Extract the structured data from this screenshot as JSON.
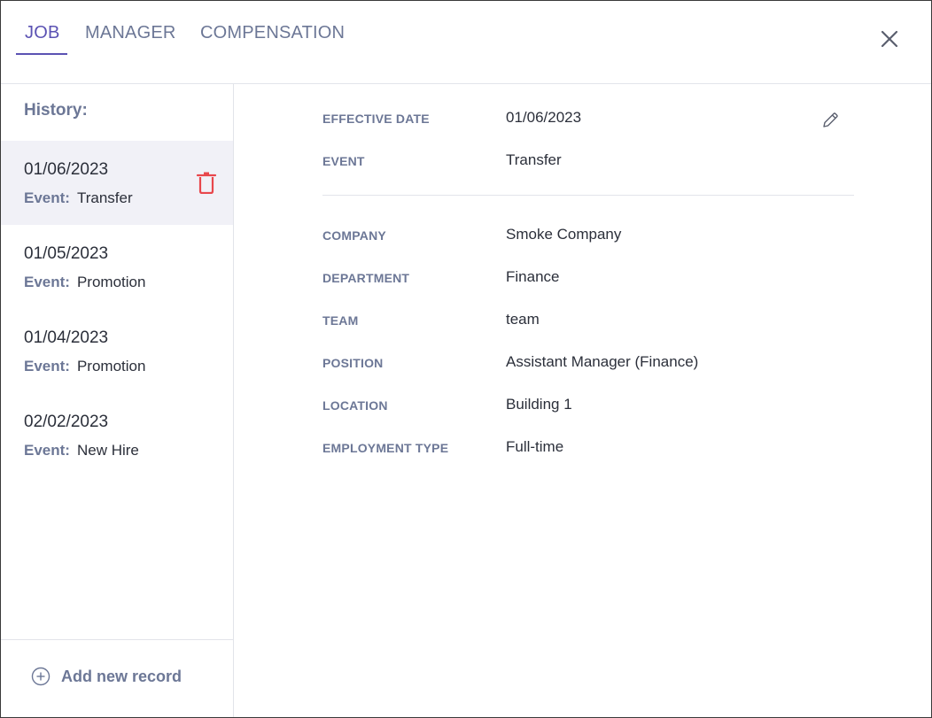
{
  "tabs": [
    {
      "label": "JOB",
      "active": true
    },
    {
      "label": "MANAGER",
      "active": false
    },
    {
      "label": "COMPENSATION",
      "active": false
    }
  ],
  "sidebar": {
    "title": "History:",
    "event_label": "Event:",
    "items": [
      {
        "date": "01/06/2023",
        "event": "Transfer",
        "selected": true
      },
      {
        "date": "01/05/2023",
        "event": "Promotion",
        "selected": false
      },
      {
        "date": "01/04/2023",
        "event": "Promotion",
        "selected": false
      },
      {
        "date": "02/02/2023",
        "event": "New Hire",
        "selected": false
      }
    ],
    "add_record_label": "Add new record"
  },
  "details": {
    "effective_date": {
      "label": "EFFECTIVE DATE",
      "value": "01/06/2023"
    },
    "event": {
      "label": "EVENT",
      "value": "Transfer"
    },
    "company": {
      "label": "COMPANY",
      "value": "Smoke Company"
    },
    "department": {
      "label": "DEPARTMENT",
      "value": "Finance"
    },
    "team": {
      "label": "TEAM",
      "value": "team"
    },
    "position": {
      "label": "POSITION",
      "value": "Assistant Manager (Finance)"
    },
    "location": {
      "label": "LOCATION",
      "value": "Building 1"
    },
    "employment_type": {
      "label": "EMPLOYMENT TYPE",
      "value": "Full-time"
    }
  },
  "icons": {
    "close": "close-icon",
    "delete": "trash-icon",
    "edit": "pencil-icon",
    "add": "plus-circle-icon"
  },
  "colors": {
    "accent": "#5b52b3",
    "label": "#6c7796",
    "delete": "#e8474c",
    "selected_bg": "#f1f1f7"
  }
}
